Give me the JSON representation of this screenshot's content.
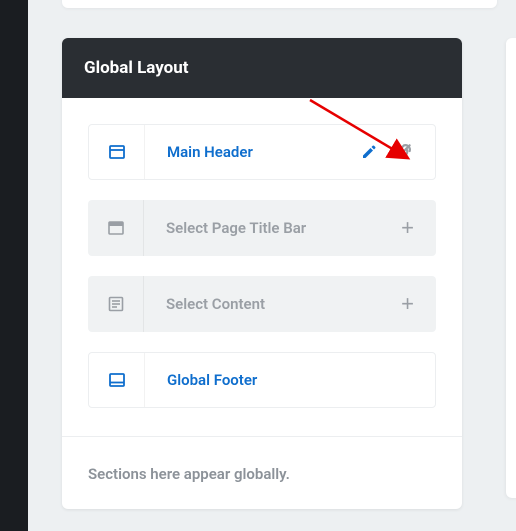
{
  "panel": {
    "title": "Global Layout",
    "rows": [
      {
        "icon": "header",
        "label": "Main Header",
        "state": "active",
        "actions": [
          "edit",
          "unlink"
        ]
      },
      {
        "icon": "titlebar",
        "label": "Select Page Title Bar",
        "state": "placeholder",
        "actions": [
          "add"
        ]
      },
      {
        "icon": "content",
        "label": "Select Content",
        "state": "placeholder",
        "actions": [
          "add"
        ]
      },
      {
        "icon": "footer",
        "label": "Global Footer",
        "state": "active",
        "actions": []
      }
    ],
    "hint": "Sections here appear globally."
  },
  "colors": {
    "accent": "#0f6ecd",
    "muted": "#9a9fa5",
    "panel_header": "#2a2e33"
  }
}
